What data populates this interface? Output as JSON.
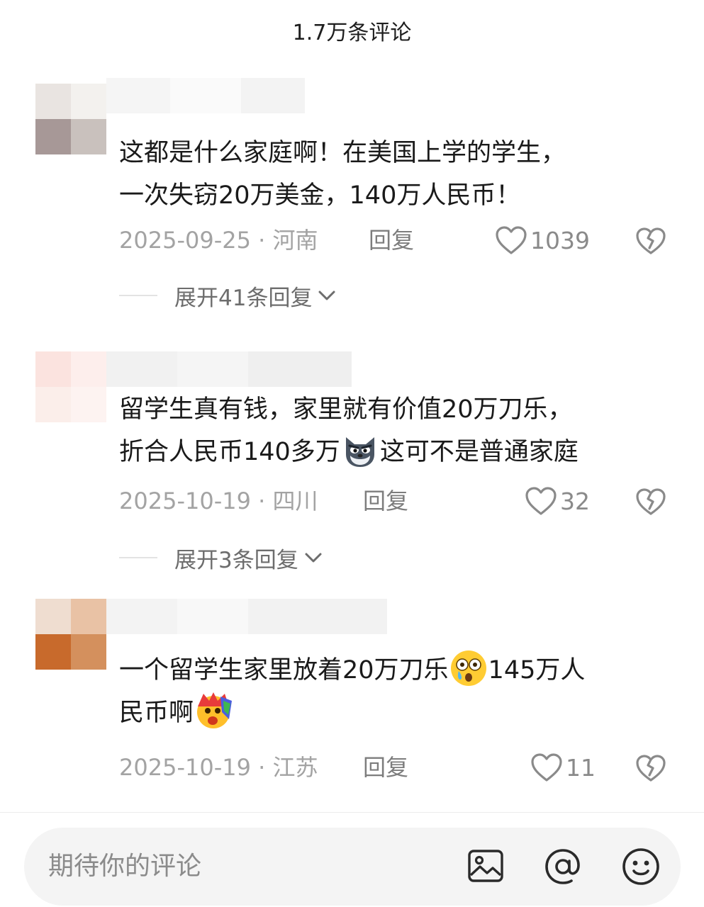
{
  "header": {
    "title": "1.7万条评论"
  },
  "comments": [
    {
      "text_lines": [
        "这都是什么家庭啊！在美国上学的学生，",
        "一次失窃20万美金，140万人民币！"
      ],
      "date": "2025-09-25 · 河南",
      "reply_label": "回复",
      "likes": "1039",
      "expand_label": "展开41条回复"
    },
    {
      "text_line1": "留学生真有钱，家里就有价值20万刀乐，",
      "text_line2_a": "折合人民币140多万",
      "text_line2_b": "这可不是普通家庭",
      "emoji_1": "wolf-emoji",
      "date": "2025-10-19 · 四川",
      "reply_label": "回复",
      "likes": "32",
      "expand_label": "展开3条回复"
    },
    {
      "text_line1_a": "一个留学生家里放着20万刀乐",
      "text_line1_b": "145万人",
      "text_line2": "民币啊",
      "emoji_1": "shocked-tear-emoji",
      "emoji_2": "rainbow-shock-emoji",
      "date": "2025-10-19 · 江苏",
      "reply_label": "回复",
      "likes": "11"
    }
  ],
  "input": {
    "placeholder": "期待你的评论"
  },
  "icons": {
    "like": "heart-outline-icon",
    "dislike": "broken-heart-icon",
    "expand": "chevron-down-icon",
    "image": "image-icon",
    "mention": "at-icon",
    "emoji": "smiley-icon"
  }
}
